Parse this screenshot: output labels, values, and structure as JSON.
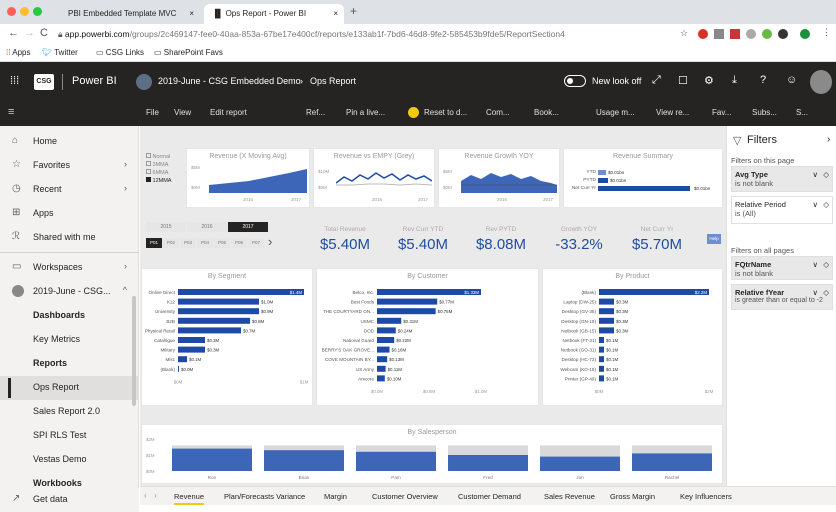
{
  "browser": {
    "tabs": [
      {
        "title": "PBI Embedded Template MVC"
      },
      {
        "title": "Ops Report - Power BI"
      }
    ],
    "url_host": "app.powerbi.com",
    "url_path": "/groups/2c469147-fee0-40aa-853a-67be17e400cf/reports/e133ab1f-7bd6-46d8-9fe2-585453b9fde5/ReportSection4",
    "bookmarks": [
      "Apps",
      "Twitter",
      "CSG Links",
      "SharePoint Favs"
    ]
  },
  "header": {
    "logo_badge": "CSG",
    "app_name": "Power BI",
    "breadcrumb_workspace": "2019-June - CSG Embedded Demo",
    "breadcrumb_report": "Ops Report",
    "new_look": "New look off"
  },
  "toolbar": [
    "File",
    "View",
    "Edit report",
    "Ref...",
    "Pin a live...",
    "Reset to d...",
    "Com...",
    "Book...",
    "Usage m...",
    "View re...",
    "Fav...",
    "Subs...",
    "S..."
  ],
  "nav": {
    "items": [
      {
        "label": "Home",
        "icon": "home-icon"
      },
      {
        "label": "Favorites",
        "icon": "star-icon"
      },
      {
        "label": "Recent",
        "icon": "clock-icon"
      },
      {
        "label": "Apps",
        "icon": "apps-icon"
      },
      {
        "label": "Shared with me",
        "icon": "shared-icon"
      }
    ],
    "workspaces": "Workspaces",
    "current_ws": "2019-June - CSG...",
    "sub": [
      "Dashboards",
      "Key Metrics",
      "Reports",
      "Ops Report",
      "Sales Report 2.0",
      "SPI RLS Test",
      "Vestas Demo",
      "Workbooks"
    ],
    "get_data": "Get data"
  },
  "report": {
    "legend": [
      "Normal",
      "3MMA",
      "6MMA",
      "12MMA"
    ],
    "years": [
      "2015",
      "2016",
      "2017"
    ],
    "periods": [
      "P01",
      "P02",
      "P03",
      "P04",
      "P05",
      "P06",
      "P07"
    ],
    "chart_titles": [
      "Revenue (X Moving Avg)",
      "Revenue vs EMPY (Grey)",
      "Revenue Growth YOY",
      "Revenue Summary"
    ],
    "chart_axis": {
      "rev_y": [
        "$5M",
        "$0M"
      ],
      "rev_x": [
        "2016",
        "2017"
      ],
      "emp_y": [
        "$10M",
        "$0M"
      ],
      "emp_x": [
        "2016",
        "2017"
      ],
      "gr_y": [
        "$5M",
        "$0M"
      ],
      "gr_x": [
        "2016",
        "2017"
      ]
    },
    "summary": [
      {
        "label": "YTD",
        "value": "$0.01bn"
      },
      {
        "label": "PYTD",
        "value": "$0.01bn"
      },
      {
        "label": "Net Curr Yr",
        "value": "$0.01bn"
      }
    ],
    "kpis": [
      {
        "label": "Total Revenue",
        "value": "$5.40M"
      },
      {
        "label": "Rev Curr YTD",
        "value": "$5.40M"
      },
      {
        "label": "Rev PYTD",
        "value": "$8.08M"
      },
      {
        "label": "Growth YOY",
        "value": "-33.2%"
      },
      {
        "label": "Net Curr Yr",
        "value": "$5.70M"
      }
    ],
    "help": "Help",
    "seg_title": "By Segment",
    "cust_title": "By Customer",
    "prod_title": "By Product",
    "sales_title": "By Salesperson"
  },
  "chart_data": [
    {
      "type": "bar",
      "title": "By Segment",
      "categories": [
        "Online Direct",
        "K12",
        "University",
        "B2B",
        "Physical Retail",
        "Catalogue",
        "Military",
        "Misc",
        "(Blank)"
      ],
      "values": [
        1.4,
        0.9,
        0.9,
        0.8,
        0.7,
        0.3,
        0.3,
        0.1,
        0.0
      ],
      "value_labels": [
        "$1.4M",
        "$1.0M",
        "$0.9M",
        "$0.8M",
        "$0.7M",
        "$0.3M",
        "$0.3M",
        "$0.1M",
        "$0.0M"
      ],
      "xticks": [
        "$0M",
        "$1M"
      ]
    },
    {
      "type": "bar",
      "title": "By Customer",
      "categories": [
        "Belco, Inc.",
        "Best Foods",
        "THE COURTYARD ON...",
        "USMC",
        "DOD",
        "National Guard",
        "BERRY'S OAK GROVE...",
        "COVE MOUNTAIN BY...",
        "US Army",
        "Amcore"
      ],
      "values": [
        1.33,
        0.77,
        0.75,
        0.31,
        0.24,
        0.22,
        0.16,
        0.13,
        0.11,
        0.1
      ],
      "value_labels": [
        "$1.33M",
        "$0.77M",
        "$0.75M",
        "$0.31M",
        "$0.24M",
        "$0.22M",
        "$0.16M",
        "$0.13M",
        "$0.11M",
        "$0.10M"
      ],
      "xticks": [
        "$0.0M",
        "$0.5M",
        "$1.0M"
      ]
    },
    {
      "type": "bar",
      "title": "By Product",
      "categories": [
        "(Blank)",
        "Laptop (DW-25)",
        "Desktop (GV-35)",
        "Desktop (GN-19)",
        "Netbook (GB-15)",
        "Netbook (FT-31)",
        "Netbook (GO-31)",
        "Desktop (HC-73)",
        "Webcam (KO-15)",
        "Printer (GP-49)"
      ],
      "values": [
        2.2,
        0.3,
        0.3,
        0.3,
        0.3,
        0.1,
        0.1,
        0.1,
        0.1,
        0.1
      ],
      "value_labels": [
        "$2.2M",
        "$0.3M",
        "$0.3M",
        "$0.3M",
        "$0.3M",
        "$0.1M",
        "$0.1M",
        "$0.1M",
        "$0.1M",
        "$0.1M"
      ],
      "xticks": [
        "$0M",
        "$2M"
      ]
    },
    {
      "type": "bar",
      "title": "By Salesperson",
      "categories": [
        "Ron",
        "Brian",
        "Pam",
        "Fred",
        "Jon",
        "Rachel"
      ],
      "series": [
        {
          "values": [
            1.4,
            1.3,
            1.2,
            1.0,
            0.9,
            1.1
          ]
        },
        {
          "values": [
            1.6,
            1.6,
            1.6,
            1.6,
            1.6,
            1.6
          ]
        }
      ],
      "yticks": [
        "$2M",
        "$1M",
        "$0M"
      ]
    }
  ],
  "filters": {
    "title": "Filters",
    "on_page": "Filters on this page",
    "page": [
      {
        "name": "Avg Type",
        "cond": "is not blank"
      },
      {
        "name": "Relative Period",
        "cond": "is (All)"
      }
    ],
    "on_all": "Filters on all pages",
    "all": [
      {
        "name": "FQtrName",
        "cond": "is not blank"
      },
      {
        "name": "Relative fYear",
        "cond": "is greater than or equal to -2"
      }
    ]
  },
  "bottom_tabs": [
    "Revenue",
    "Plan/Forecasts Variance",
    "Margin",
    "Customer Overview",
    "Customer Demand",
    "Sales Revenue",
    "Gross Margin",
    "Key Influencers"
  ]
}
